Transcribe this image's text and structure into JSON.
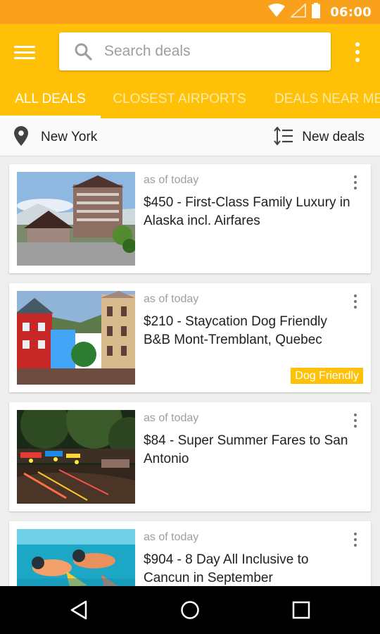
{
  "status_bar": {
    "time": "06:00",
    "icons": [
      "wifi-icon",
      "signal-icon",
      "battery-icon"
    ]
  },
  "toolbar": {
    "menu_icon": "hamburger-menu-icon",
    "search_placeholder": "Search deals",
    "search_value": "",
    "overflow_icon": "more-vert-icon"
  },
  "tabs": [
    {
      "label": "ALL DEALS",
      "active": true
    },
    {
      "label": "CLOSEST AIRPORTS",
      "active": false
    },
    {
      "label": "DEALS NEAR ME",
      "active": false
    }
  ],
  "filter": {
    "location": "New York",
    "sort": "New deals"
  },
  "deals": [
    {
      "meta": "as of today",
      "title": "$450 - First-Class Family Luxury in Alaska incl. Airfares",
      "badge": ""
    },
    {
      "meta": "as of today",
      "title": "$210 - Staycation Dog Friendly B&B Mont-Tremblant, Quebec",
      "badge": "Dog Friendly"
    },
    {
      "meta": "as of today",
      "title": "$84 - Super Summer Fares to San Antonio",
      "badge": ""
    },
    {
      "meta": "as of today",
      "title": "$904 - 8 Day All Inclusive to Cancun in September",
      "badge": ""
    }
  ],
  "colors": {
    "primary": "#ffc107",
    "status_bar": "#f9a11b",
    "badge": "#ffc107"
  },
  "nav": [
    "back-icon",
    "home-icon",
    "recents-icon"
  ]
}
